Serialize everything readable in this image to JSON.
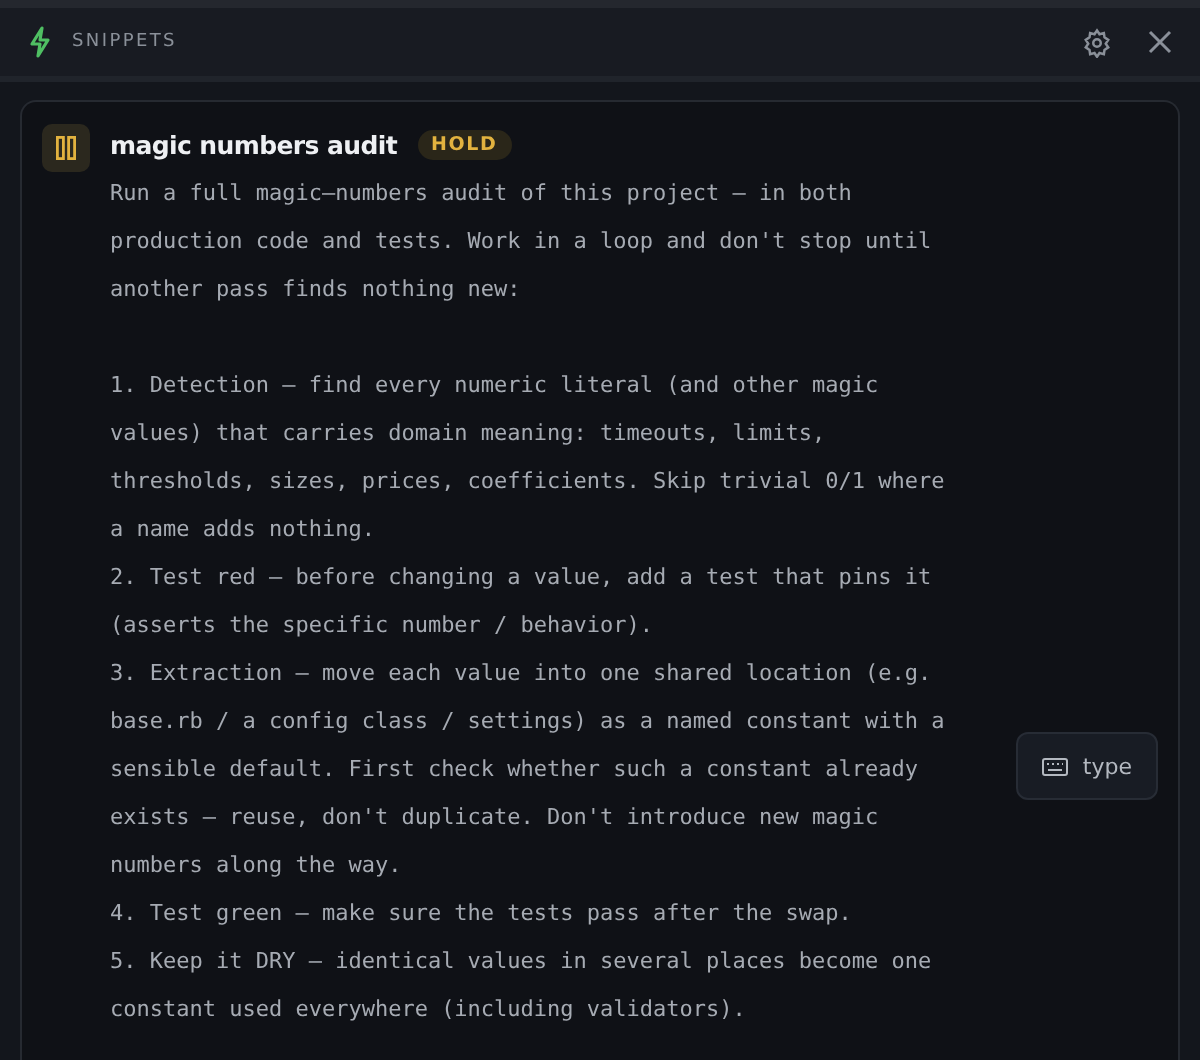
{
  "header": {
    "title": "SNIPPETS"
  },
  "snippet": {
    "title": "magic numbers audit",
    "status": "HOLD",
    "paused": true,
    "paragraphs": [
      {
        "lines": [
          "Run a full magic–numbers audit of this project – in both",
          "production code and tests. Work in a loop and don't stop until",
          "another pass finds nothing new:"
        ]
      },
      {
        "lines": [
          "1. Detection – find every numeric literal (and other magic",
          "values) that carries domain meaning: timeouts, limits,",
          "thresholds, sizes, prices, coefficients. Skip trivial 0/1 where",
          "a name adds nothing.",
          "2. Test red – before changing a value, add a test that pins it",
          "(asserts the specific number / behavior).",
          "3. Extraction – move each value into one shared location (e.g.",
          "base.rb / a config class / settings) as a named constant with a",
          "sensible default. First check whether such a constant already",
          "exists – reuse, don't duplicate. Don't introduce new magic",
          "numbers along the way.",
          "4. Test green – make sure the tests pass after the swap.",
          "5. Keep it DRY – identical values in several places become one",
          "constant used everywhere (including validators)."
        ]
      }
    ],
    "type_button": "type"
  }
}
